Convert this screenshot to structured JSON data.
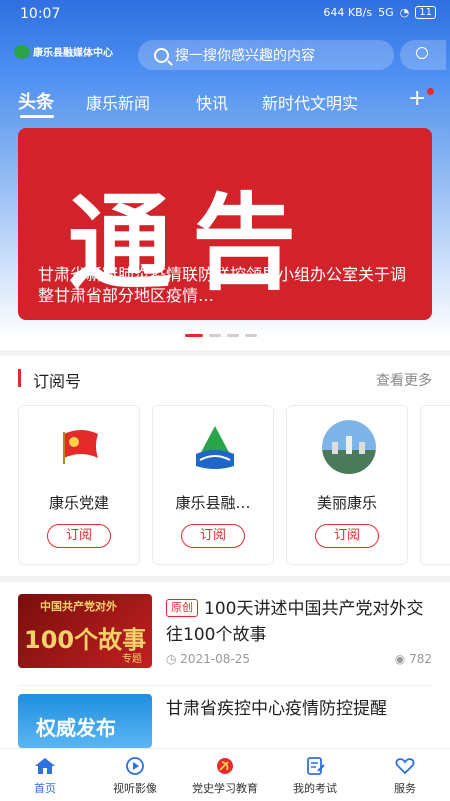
{
  "status_bar": {
    "time": "10:07",
    "net_speed": "644 KB/s",
    "signal": "5G",
    "battery": "11"
  },
  "header": {
    "logo_text": "康乐县融媒体中心",
    "search_placeholder": "搜一搜你感兴趣的内容"
  },
  "tabs": [
    {
      "label": "头条",
      "active": true
    },
    {
      "label": "康乐新闻",
      "active": false
    },
    {
      "label": "快讯",
      "active": false
    },
    {
      "label": "新时代文明实",
      "active": false
    }
  ],
  "banner": {
    "big_text": "通告",
    "caption": "甘肃省新冠肺炎疫情联防联控领导小组办公室关于调整甘肃省部分地区疫情…",
    "slide_count": 4,
    "active_slide": 1
  },
  "subscribe": {
    "title": "订阅号",
    "more": "查看更多",
    "cards": [
      {
        "name": "康乐党建",
        "button": "订阅",
        "icon": "party-flag-icon"
      },
      {
        "name": "康乐县融…",
        "button": "订阅",
        "icon": "county-media-logo-icon"
      },
      {
        "name": "美丽康乐",
        "button": "订阅",
        "icon": "scenic-city-icon"
      }
    ]
  },
  "news": [
    {
      "tag": "原创",
      "title": "100天讲述中国共产党对外交往100个故事",
      "date": "2021-08-25",
      "views": "782",
      "thumb_text_top": "中国共产党对外",
      "thumb_text_mid": "100个故事",
      "thumb_text_side": "专题"
    },
    {
      "tag": "",
      "title": "甘肃省疾控中心疫情防控提醒",
      "thumb_text_mid": "权威发布"
    }
  ],
  "bottom_nav": [
    {
      "label": "首页",
      "icon": "home-icon",
      "active": true
    },
    {
      "label": "视听影像",
      "icon": "play-icon",
      "active": false
    },
    {
      "label": "党史学习教育",
      "icon": "party-emblem-icon",
      "active": false
    },
    {
      "label": "我的考试",
      "icon": "exam-icon",
      "active": false
    },
    {
      "label": "服务",
      "icon": "heart-icon",
      "active": false
    }
  ],
  "colors": {
    "brand_blue": "#2f6fe0",
    "accent_red": "#e42b2b",
    "banner_red": "#d3232a"
  }
}
